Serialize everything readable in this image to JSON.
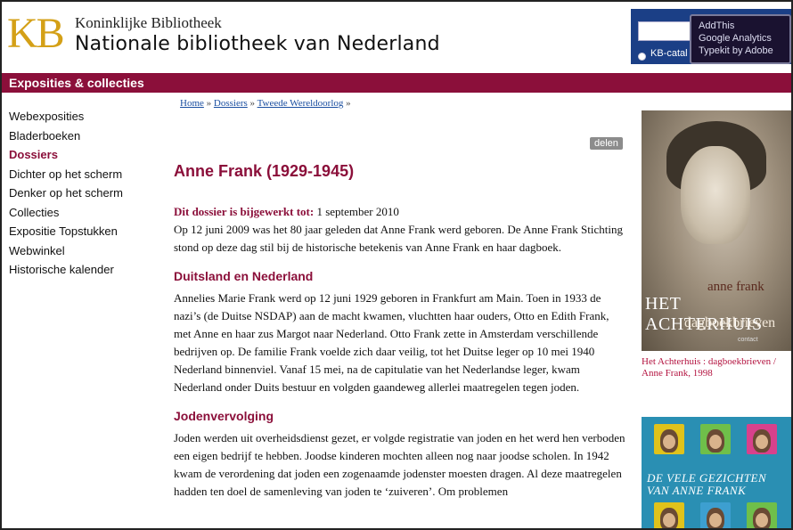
{
  "header": {
    "logo_text": "KB",
    "org_line1": "Koninklijke Bibliotheek",
    "org_line2": "Nationale bibliotheek van Nederland",
    "search_radio_label": "KB-catal"
  },
  "privacy_popup": {
    "items": [
      "AddThis",
      "Google Analytics",
      "Typekit by Adobe"
    ]
  },
  "section_bar": {
    "label": "Exposities & collecties"
  },
  "sidebar": {
    "items": [
      {
        "label": "Webexposities",
        "active": false
      },
      {
        "label": "Bladerboeken",
        "active": false
      },
      {
        "label": "Dossiers",
        "active": true
      },
      {
        "label": "Dichter op het scherm",
        "active": false
      },
      {
        "label": "Denker op het scherm",
        "active": false
      },
      {
        "label": "Collecties",
        "active": false
      },
      {
        "label": "Expositie Topstukken",
        "active": false
      },
      {
        "label": "Webwinkel",
        "active": false
      },
      {
        "label": "Historische kalender",
        "active": false
      }
    ]
  },
  "breadcrumb": {
    "items": [
      "Home",
      "Dossiers",
      "Tweede Wereldoorlog"
    ],
    "separator": "»"
  },
  "share_label": "delen",
  "article": {
    "title": "Anne Frank (1929-1945)",
    "updated_label": "Dit dossier is bijgewerkt tot:",
    "updated_value": "1 september 2010",
    "intro": "Op 12 juni 2009 was het 80 jaar geleden dat Anne Frank werd geboren. De Anne Frank Stichting stond op deze dag stil bij de historische betekenis van Anne Frank en haar dagboek.",
    "sections": [
      {
        "heading": "Duitsland en Nederland",
        "text": "Annelies Marie Frank werd op 12 juni 1929 geboren in Frankfurt am Main. Toen in 1933 de nazi’s (de Duitse NSDAP) aan de macht kwamen, vluchtten haar ouders, Otto en Edith Frank, met Anne en haar zus Margot naar Nederland. Otto Frank zette in Amsterdam verschillende bedrijven op. De familie Frank voelde zich daar veilig, tot het Duitse leger op 10 mei 1940 Nederland binnenviel. Vanaf 15 mei, na de capitulatie van het Nederlandse leger, kwam Nederland onder Duits bestuur en volgden gaandeweg allerlei maatregelen tegen joden."
      },
      {
        "heading": "Jodenvervolging",
        "text": "Joden werden uit overheidsdienst gezet, er volgde registratie van joden en het werd hen verboden een eigen bedrijf te hebben. Joodse kinderen mochten alleen nog naar joodse scholen. In 1942 kwam de verordening dat joden een zogenaamde jodenster moesten dragen. Al deze maatregelen hadden ten doel de samenleving van joden te ‘zuiveren’. Om problemen"
      }
    ]
  },
  "right_column": {
    "book1": {
      "author": "anne frank",
      "title": "HET ACHTERHUIS",
      "subtitle": "dagboekbrieven",
      "publisher": "contact",
      "caption": "Het Achterhuis : dagboekbrieven / Anne Frank, 1998"
    },
    "book2": {
      "title_line1": "DE VELE GEZICHTEN",
      "title_line2": "VAN ANNE FRANK",
      "tile_colors": [
        "#e0c21b",
        "#6fbf4a",
        "#d8418c",
        "#e0c21b",
        "#3d9fd0",
        "#6fbf4a"
      ]
    }
  },
  "colors": {
    "brand_red": "#8b0f3a",
    "logo_gold": "#d4a017",
    "search_blue": "#1b3f86",
    "link_blue": "#1a4ea0"
  }
}
